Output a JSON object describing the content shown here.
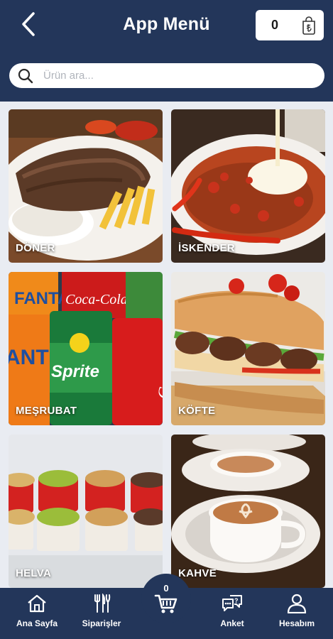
{
  "header": {
    "title": "App Menü",
    "back_icon": "chevron-left-icon",
    "cart_count": "0",
    "cart_icon": "shopping-bag-lira-icon"
  },
  "search": {
    "placeholder": "Ürün ara...",
    "value": ""
  },
  "categories": [
    {
      "label": "DÖNER"
    },
    {
      "label": "İSKENDER"
    },
    {
      "label": "MEŞRUBAT"
    },
    {
      "label": "KÖFTE"
    },
    {
      "label": "HELVA"
    },
    {
      "label": "KAHVE"
    }
  ],
  "bottom_nav": {
    "items": [
      {
        "label": "Ana Sayfa",
        "icon": "home-icon"
      },
      {
        "label": "Siparişler",
        "icon": "cutlery-icon"
      },
      {
        "label": "Anket",
        "icon": "survey-chat-icon"
      },
      {
        "label": "Hesabım",
        "icon": "user-icon"
      }
    ],
    "cart": {
      "count": "0",
      "icon": "cart-icon"
    }
  },
  "colors": {
    "primary": "#23365a",
    "background": "#e9ecf2",
    "white": "#ffffff"
  }
}
